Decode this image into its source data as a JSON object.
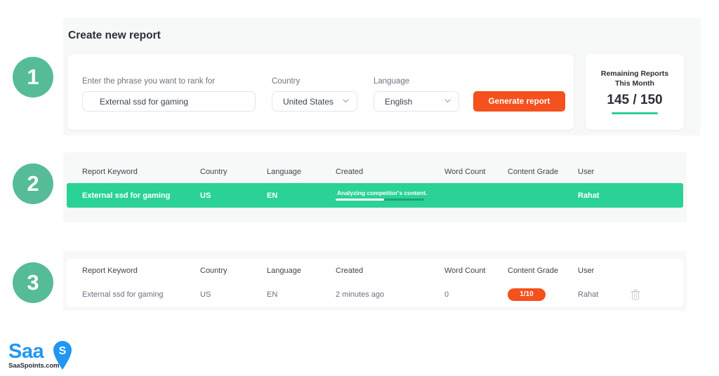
{
  "steps": [
    {
      "number": "1"
    },
    {
      "number": "2"
    },
    {
      "number": "3"
    }
  ],
  "form": {
    "title": "Create new report",
    "phrase_label": "Enter the phrase you want to rank for",
    "phrase_value": "External ssd for gaming",
    "phrase_placeholder": "Enter the phrase you want to rank for",
    "country_label": "Country",
    "country_value": "United States",
    "language_label": "Language",
    "language_value": "English",
    "generate_label": "Generate report"
  },
  "remaining": {
    "title": "Remaining Reports\nThis Month",
    "value": "145 / 150",
    "accent": "#2ecf94"
  },
  "table_headers": {
    "keyword": "Report Keyword",
    "country": "Country",
    "language": "Language",
    "created": "Created",
    "word_count": "Word Count",
    "content_grade": "Content Grade",
    "user": "User"
  },
  "in_progress_row": {
    "keyword": "External ssd for gaming",
    "country": "US",
    "language": "EN",
    "progress_text": "Analyzing competitor's content.",
    "progress_percent": 55,
    "word_count": "",
    "content_grade": "",
    "user": "Rahat",
    "row_color": "#2ad295"
  },
  "completed_row": {
    "keyword": "External ssd for gaming",
    "country": "US",
    "language": "EN",
    "created": "2 minutes ago",
    "word_count": "0",
    "content_grade": "1/10",
    "grade_color": "#f4511e",
    "user": "Rahat",
    "delete_icon": "trash-icon"
  },
  "logo": {
    "word": "Saa",
    "pin_letter": "S",
    "sub": "SaaSpoints.com",
    "color": "#2196f3"
  }
}
